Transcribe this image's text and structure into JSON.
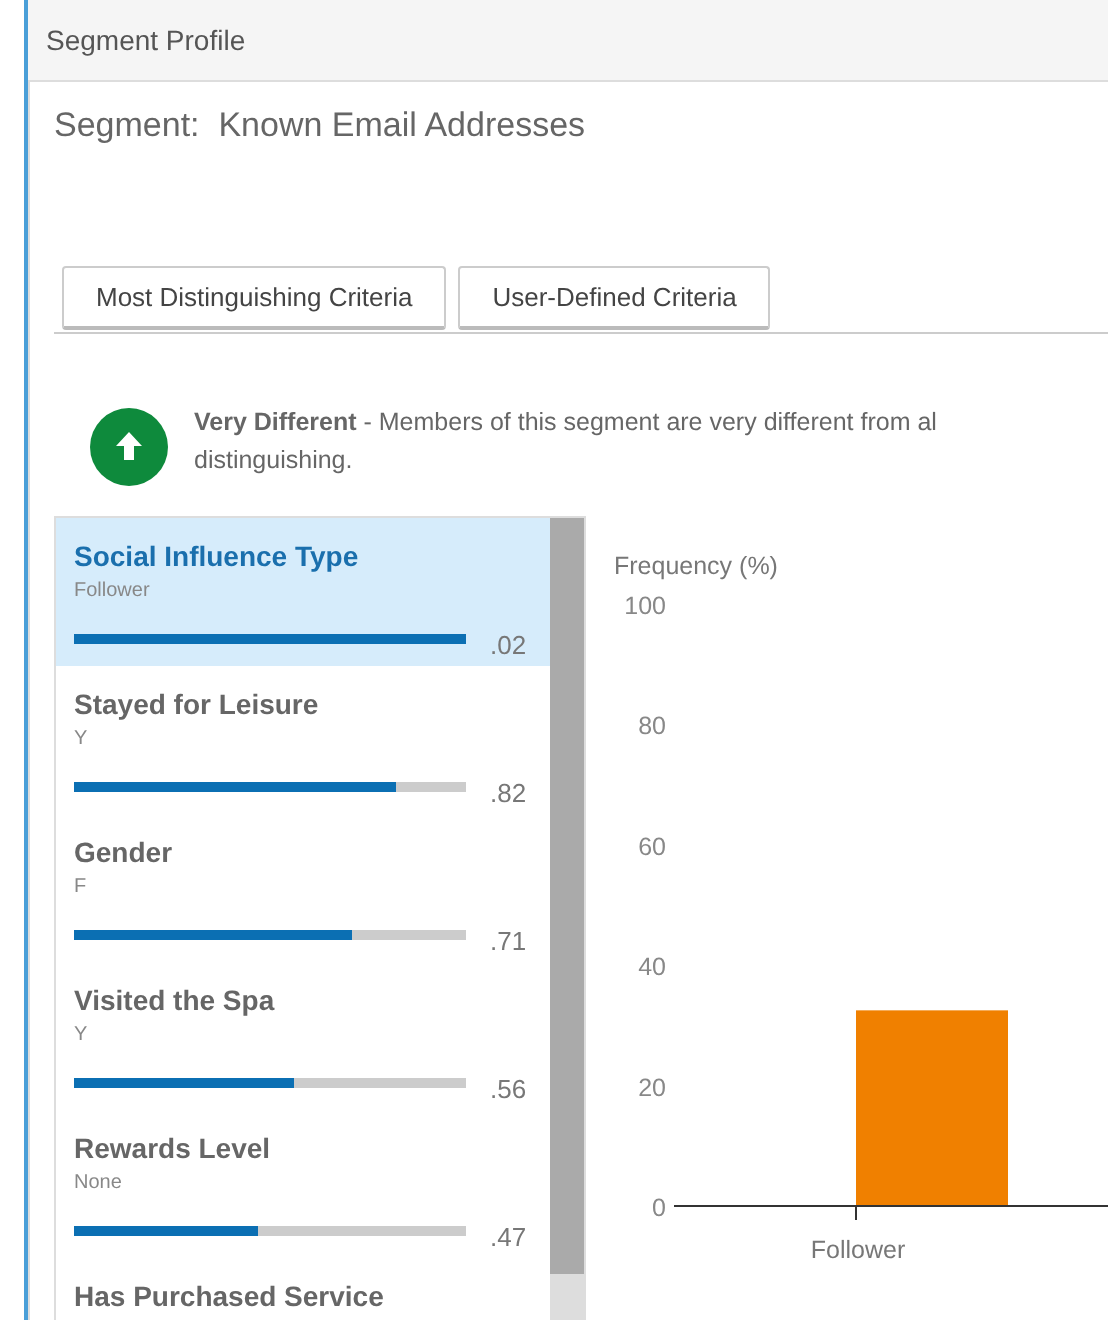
{
  "header": {
    "title": "Segment Profile"
  },
  "segment": {
    "label": "Segment:",
    "name": "Known Email Addresses"
  },
  "tabs": [
    {
      "label": "Most Distinguishing Criteria",
      "selected": false
    },
    {
      "label": "User-Defined Criteria",
      "selected": false
    }
  ],
  "summary": {
    "text": "**Very Different** - Members of this segment are very different from al\ndistinguishing."
  },
  "criteria": [
    {
      "name": "Social Influence Type",
      "value": "Follower",
      "level": 1,
      "score": ".02",
      "selected": true
    },
    {
      "name": "Stayed for Leisure",
      "value": "Y",
      "level": 0.82,
      "score": ".82",
      "selected": false
    },
    {
      "name": "Gender",
      "value": "F",
      "level": 0.71,
      "score": ".71",
      "selected": false
    },
    {
      "name": "Visited the Spa",
      "value": "Y",
      "level": 0.56,
      "score": ".56",
      "selected": false
    },
    {
      "name": "Rewards Level",
      "value": "None",
      "level": 0.47,
      "score": ".47",
      "selected": false
    },
    {
      "name": "Has Purchased Service",
      "selected": false
    }
  ],
  "chart": {
    "chart_data": {
      "type": "bar",
      "ylabel": "Frequency (%)",
      "categories": [
        "Follower"
      ],
      "series": [
        {
          "color": "#f08000",
          "values": [
            32.5
          ]
        }
      ],
      "ylim": [
        0,
        100
      ],
      "yticks": [
        0,
        20,
        40,
        60,
        80,
        100
      ]
    }
  }
}
